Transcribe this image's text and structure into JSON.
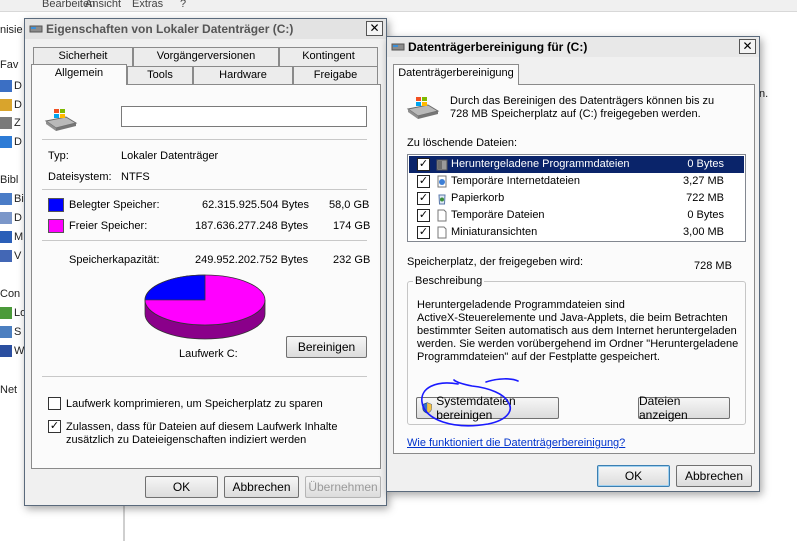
{
  "background": {
    "menu": [
      "Bearbeiten",
      "Ansicht",
      "Extras",
      "?"
    ],
    "side_items": [
      {
        "label": "nisie",
        "color": ""
      },
      {
        "label": "Fav",
        "color": ""
      },
      {
        "label": "D",
        "color": "#3b6fc4"
      },
      {
        "label": "D",
        "color": "#d9a42c"
      },
      {
        "label": "Z",
        "color": "#7a7a7a"
      },
      {
        "label": "D",
        "color": "#2d7bd6"
      },
      {
        "label": "Bibl",
        "color": ""
      },
      {
        "label": "Bi",
        "color": "#4a7cc7"
      },
      {
        "label": "D",
        "color": "#7b97c9"
      },
      {
        "label": "M",
        "color": "#2a5fb8"
      },
      {
        "label": "V",
        "color": "#4367b5"
      },
      {
        "label": "Con",
        "color": ""
      },
      {
        "label": "Lo",
        "color": "#4b9a3a"
      },
      {
        "label": "S",
        "color": "#4c7fc0"
      },
      {
        "label": "W",
        "color": "#2b4fa0"
      },
      {
        "label": "Net",
        "color": ""
      }
    ],
    "right_fragment": "n."
  },
  "properties": {
    "title": "Eigenschaften von Lokaler Datenträger (C:)",
    "close": "✕",
    "tabs_row1": [
      "Sicherheit",
      "Vorgängerversionen",
      "Kontingent"
    ],
    "tabs_row2": [
      "Allgemein",
      "Tools",
      "Hardware",
      "Freigabe"
    ],
    "name_value": "",
    "type_label": "Typ:",
    "type_value": "Lokaler Datenträger",
    "fs_label": "Dateisystem:",
    "fs_value": "NTFS",
    "used_label": "Belegter Speicher:",
    "used_bytes": "62.315.925.504 Bytes",
    "used_gb": "58,0 GB",
    "used_color": "#0000ff",
    "free_label": "Freier Speicher:",
    "free_bytes": "187.636.277.248 Bytes",
    "free_gb": "174 GB",
    "free_color": "#ff00ff",
    "cap_label": "Speicherkapazität:",
    "cap_bytes": "249.952.202.752 Bytes",
    "cap_gb": "232 GB",
    "used_fraction": 0.249,
    "drive_label": "Laufwerk C:",
    "cleanup_button": "Bereinigen",
    "compress_label": "Laufwerk komprimieren, um Speicherplatz zu sparen",
    "compress_checked": false,
    "index_label_1": "Zulassen, dass für Dateien auf diesem Laufwerk Inhalte",
    "index_label_2": "zusätzlich zu Dateieigenschaften indiziert werden",
    "index_checked": true,
    "ok": "OK",
    "cancel": "Abbrechen",
    "apply": "Übernehmen"
  },
  "cleanup": {
    "title": "Datenträgerbereinigung für  (C:)",
    "close": "✕",
    "tab": "Datenträgerbereinigung",
    "intro_1": "Durch das Bereinigen des Datenträgers können bis zu",
    "intro_2": "728 MB Speicherplatz auf  (C:) freigegeben werden.",
    "list_label": "Zu löschende Dateien:",
    "files": [
      {
        "name": "Heruntergeladene Programmdateien",
        "size": "0 Bytes",
        "checked": true,
        "selected": true,
        "icon": "folder-icon"
      },
      {
        "name": "Temporäre Internetdateien",
        "size": "3,27 MB",
        "checked": true,
        "selected": false,
        "icon": "page-icon"
      },
      {
        "name": "Papierkorb",
        "size": "722 MB",
        "checked": true,
        "selected": false,
        "icon": "recycle-bin-icon"
      },
      {
        "name": "Temporäre Dateien",
        "size": "0 Bytes",
        "checked": true,
        "selected": false,
        "icon": "file-icon"
      },
      {
        "name": "Miniaturansichten",
        "size": "3,00 MB",
        "checked": true,
        "selected": false,
        "icon": "file-icon"
      }
    ],
    "gain_label": "Speicherplatz, der freigegeben wird:",
    "gain_value": "728 MB",
    "desc_title": "Beschreibung",
    "desc_lines": [
      "Heruntergeladende Programmdateien sind",
      "ActiveX-Steuerelemente und Java-Applets, die beim Betrachten",
      "bestimmter Seiten automatisch aus dem Internet heruntergeladen",
      "werden. Sie werden vorübergehend im Ordner \"Heruntergeladene",
      "Programmdateien\" auf der Festplatte gespeichert."
    ],
    "sysfiles_button": "Systemdateien bereinigen",
    "viewfiles_button": "Dateien anzeigen",
    "help_link": "Wie funktioniert die Datenträgerbereinigung?",
    "ok": "OK",
    "cancel": "Abbrechen",
    "annotation_color": "#1a1aff"
  }
}
